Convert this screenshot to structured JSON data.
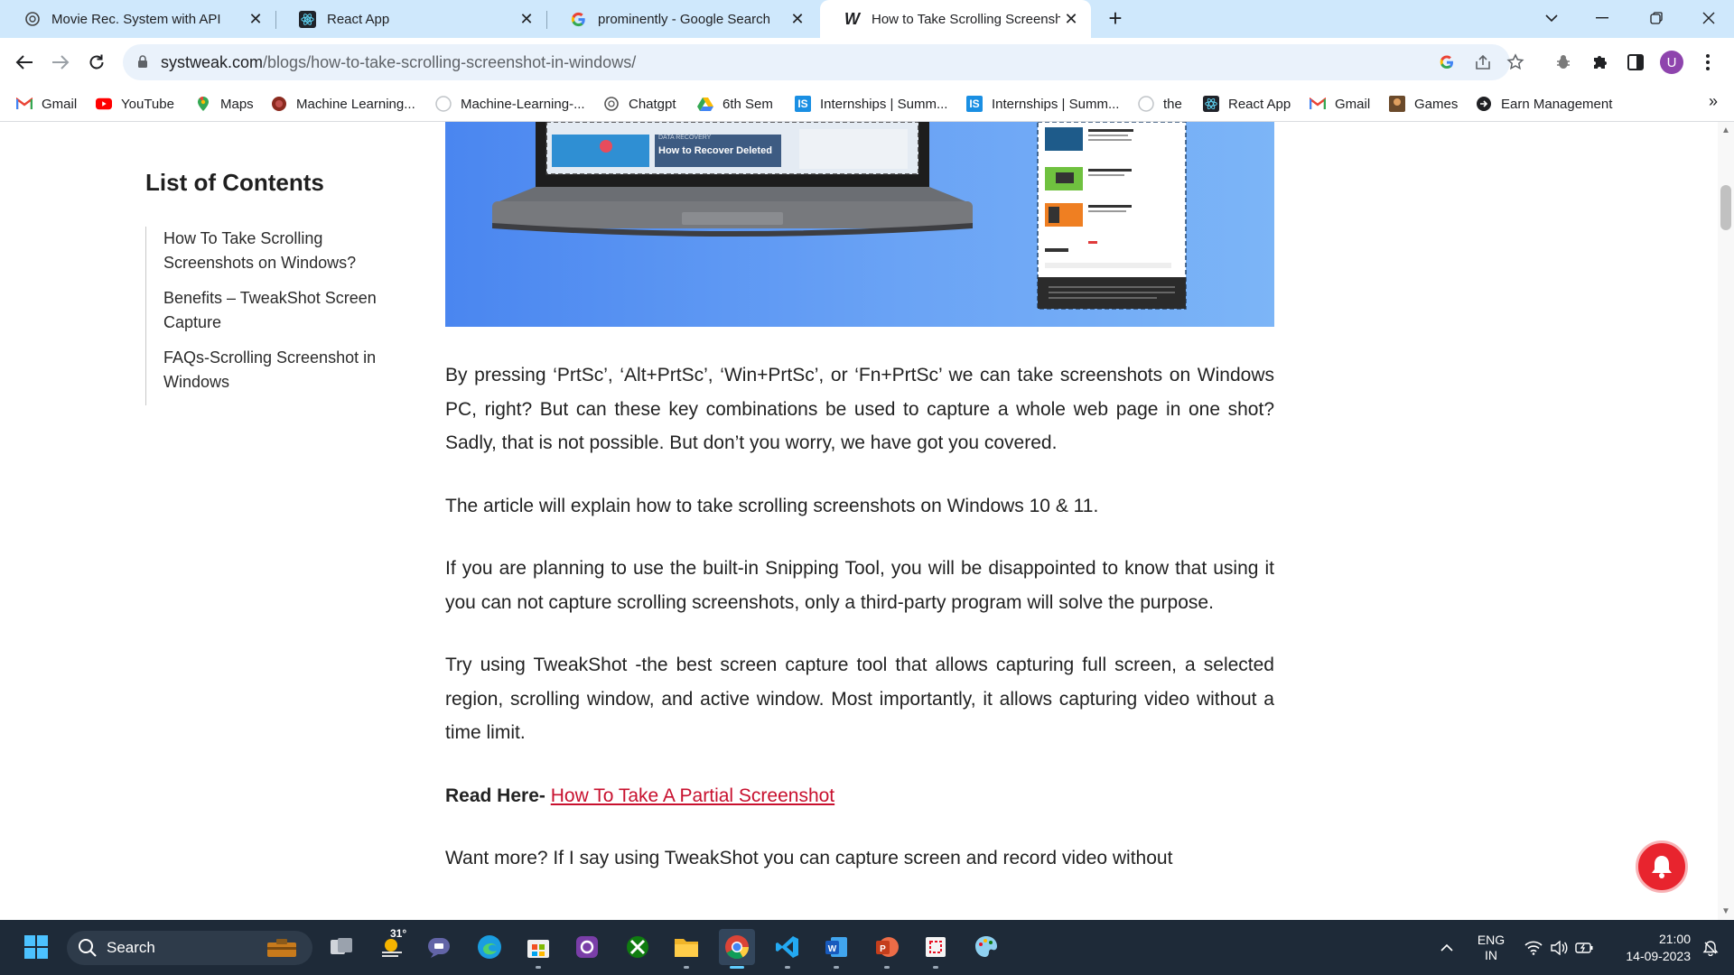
{
  "tabs": [
    {
      "title": "Movie Rec. System with API",
      "icon": "openai-icon",
      "active": false
    },
    {
      "title": "React App",
      "icon": "react-icon",
      "active": false
    },
    {
      "title": "prominently - Google Search",
      "icon": "google-icon",
      "active": false
    },
    {
      "title": "How to Take Scrolling Screenshot",
      "icon": "systweak-icon",
      "active": true
    }
  ],
  "address_bar": {
    "domain": "systweak.com",
    "path": "/blogs/how-to-take-scrolling-screenshot-in-windows/"
  },
  "profile_initial": "U",
  "bookmarks": [
    {
      "label": "Gmail",
      "icon": "gmail-icon"
    },
    {
      "label": "YouTube",
      "icon": "youtube-icon"
    },
    {
      "label": "Maps",
      "icon": "maps-icon"
    },
    {
      "label": "Machine Learning...",
      "icon": "ml-icon"
    },
    {
      "label": "Machine-Learning-...",
      "icon": "github-icon"
    },
    {
      "label": "Chatgpt",
      "icon": "openai-icon"
    },
    {
      "label": "6th Sem",
      "icon": "drive-icon"
    },
    {
      "label": "Internships | Summ...",
      "icon": "internshala-icon"
    },
    {
      "label": "Internships | Summ...",
      "icon": "internshala-icon"
    },
    {
      "label": "the",
      "icon": "github-icon"
    },
    {
      "label": "React App",
      "icon": "react-icon"
    },
    {
      "label": "Gmail",
      "icon": "gmail-icon"
    },
    {
      "label": "Games",
      "icon": "games-icon"
    },
    {
      "label": "Earn Management",
      "icon": "earn-icon"
    }
  ],
  "toc": {
    "title": "List of Contents",
    "items": [
      "How To Take Scrolling Screenshots on Windows?",
      "Benefits – TweakShot Screen Capture",
      "FAQs-Scrolling Screenshot in Windows"
    ]
  },
  "hero": {
    "thumb_label_small": "DATA RECOVERY",
    "thumb_label": "How to Recover Deleted"
  },
  "article": {
    "p1": "By pressing ‘PrtSc’, ‘Alt+PrtSc’, ‘Win+PrtSc’, or ‘Fn+PrtSc’ we can take screenshots on Windows PC, right? But can these key combinations be used to capture a whole web page in one shot? Sadly, that is not possible. But don’t you worry, we have got you covered.",
    "p2": "The article will explain how to take scrolling screenshots on Windows 10 & 11.",
    "p3": "If you are planning to use the built-in Snipping Tool, you will be disappointed to know that using it you can not capture scrolling screenshots, only a third-party program will solve the purpose.",
    "p4": "Try using TweakShot -the best screen capture tool that allows capturing full screen, a selected region, scrolling window, and active window. Most importantly, it allows capturing video without a time limit.",
    "read_here_label": "Read Here-",
    "read_here_link": "How To Take A Partial Screenshot",
    "p5": "Want more? If I say using TweakShot you can capture screen and record video without"
  },
  "taskbar": {
    "search_label": "Search",
    "weather_temp": "31°",
    "language_line1": "ENG",
    "language_line2": "IN",
    "time": "21:00",
    "date": "14-09-2023"
  },
  "colors": {
    "tabstrip_bg": "#cfe8fc",
    "link_red": "#c8102e",
    "taskbar_bg": "#1e2a38",
    "notification_red": "#e8242e"
  }
}
